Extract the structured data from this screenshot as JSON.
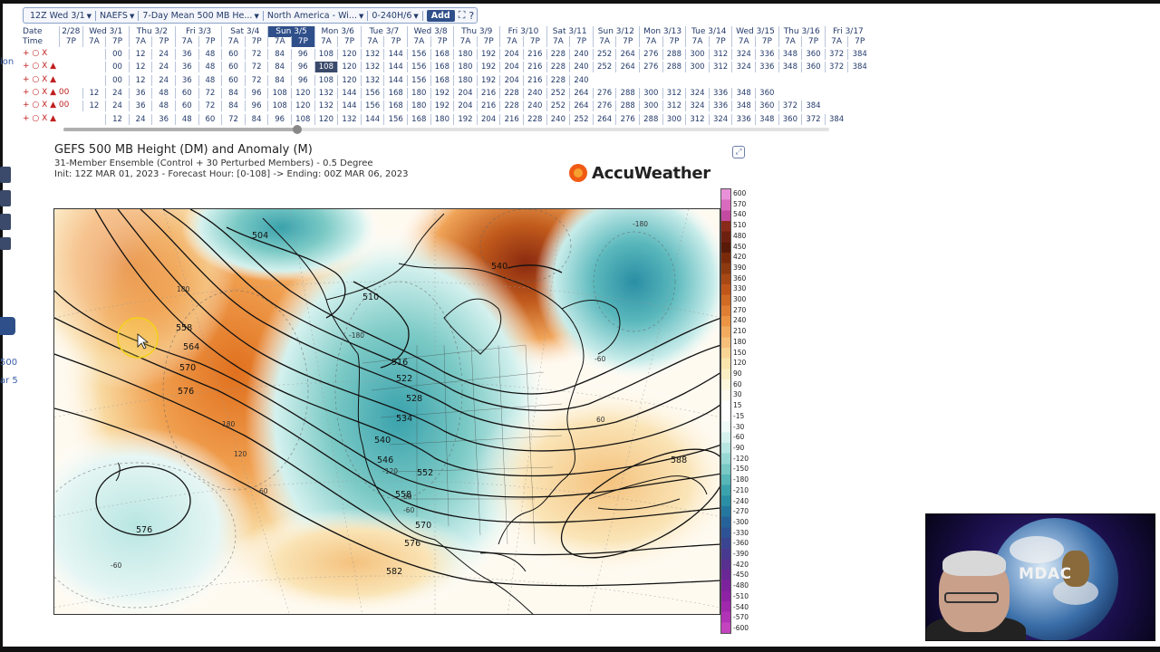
{
  "toolbar": {
    "run": "12Z Wed 3/1",
    "model": "NAEFS",
    "product": "7-Day Mean 500 MB He...",
    "region": "North America - Wi...",
    "range": "0-240H/6",
    "add_label": "Add",
    "fullscreen_icon": "expand-arrows",
    "help_label": "?"
  },
  "grid": {
    "header_date": "Date",
    "header_time": "Time",
    "days": [
      "2/28",
      "Wed 3/1",
      "Thu 3/2",
      "Fri 3/3",
      "Sat 3/4",
      "Sun 3/5",
      "Mon 3/6",
      "Tue 3/7",
      "Wed 3/8",
      "Thu 3/9",
      "Fri 3/10",
      "Sat 3/11",
      "Sun 3/12",
      "Mon 3/13",
      "Tue 3/14",
      "Wed 3/15",
      "Thu 3/16",
      "Fri 3/17"
    ],
    "times": [
      "7P",
      "7A",
      "7P",
      "7A",
      "7P",
      "7A",
      "7P",
      "7A",
      "7P",
      "7A",
      "7P",
      "7A",
      "7P",
      "7A",
      "7P",
      "7A",
      "7P",
      "7A",
      "7P",
      "7A",
      "7P",
      "7A",
      "7P",
      "7A",
      "7P",
      "7A",
      "7P",
      "7A",
      "7P",
      "7A",
      "7P",
      "7A",
      "7P",
      "7A",
      "7P"
    ],
    "rows": [
      {
        "ctrl": "+ ○ X",
        "prefix": "",
        "hours": [
          "00",
          "12",
          "24",
          "36",
          "48",
          "60",
          "72",
          "84",
          "96",
          "108",
          "120",
          "132",
          "144",
          "156",
          "168",
          "180",
          "192",
          "204",
          "216",
          "228",
          "240",
          "252",
          "264",
          "276",
          "288",
          "300",
          "312",
          "324",
          "336",
          "348",
          "360",
          "372",
          "384"
        ]
      },
      {
        "ctrl": "+ ○ X ▲",
        "prefix": "",
        "hours": [
          "00",
          "12",
          "24",
          "36",
          "48",
          "60",
          "72",
          "84",
          "96",
          "108",
          "120",
          "132",
          "144",
          "156",
          "168",
          "180",
          "192",
          "204",
          "216",
          "228",
          "240",
          "252",
          "264",
          "276",
          "288",
          "300",
          "312",
          "324",
          "336",
          "348",
          "360",
          "372",
          "384"
        ]
      },
      {
        "ctrl": "+ ○ X ▲",
        "prefix": "",
        "hours": [
          "00",
          "12",
          "24",
          "36",
          "48",
          "60",
          "72",
          "84",
          "96",
          "108",
          "120",
          "132",
          "144",
          "156",
          "168",
          "180",
          "192",
          "204",
          "216",
          "228",
          "240"
        ]
      },
      {
        "ctrl": "+ ○ X ▲ 00",
        "prefix": "",
        "hours": [
          "12",
          "24",
          "36",
          "48",
          "60",
          "72",
          "84",
          "96",
          "108",
          "120",
          "132",
          "144",
          "156",
          "168",
          "180",
          "192",
          "204",
          "216",
          "228",
          "240",
          "252",
          "264",
          "276",
          "288",
          "300",
          "312",
          "324",
          "336",
          "348",
          "360"
        ]
      },
      {
        "ctrl": "+ ○ X ▲ 00",
        "prefix": "",
        "hours": [
          "12",
          "24",
          "36",
          "48",
          "60",
          "72",
          "84",
          "96",
          "108",
          "120",
          "132",
          "144",
          "156",
          "168",
          "180",
          "192",
          "204",
          "216",
          "228",
          "240",
          "252",
          "264",
          "276",
          "288",
          "300",
          "312",
          "324",
          "336",
          "348",
          "360",
          "372",
          "384"
        ]
      },
      {
        "ctrl": "+ ○ X ▲",
        "prefix": "",
        "hours": [
          "12",
          "24",
          "36",
          "48",
          "60",
          "72",
          "84",
          "96",
          "108",
          "120",
          "132",
          "144",
          "156",
          "168",
          "180",
          "192",
          "204",
          "216",
          "228",
          "240",
          "252",
          "264",
          "276",
          "288",
          "300",
          "312",
          "324",
          "336",
          "348",
          "360",
          "372",
          "384"
        ]
      }
    ]
  },
  "left_panel": {
    "label_1": "ion",
    "label_2": "500",
    "label_3": "ar 5"
  },
  "chart": {
    "title": "GEFS 500 MB Height (DM) and Anomaly (M)",
    "subtitle_1": "31-Member Ensemble (Control + 30 Perturbed Members) - 0.5 Degree",
    "subtitle_2": "Init: 12Z MAR 01, 2023 - Forecast Hour: [0-108] -> Ending: 00Z MAR 06, 2023",
    "brand": "AccuWeather",
    "contour_labels": [
      "504",
      "510",
      "516",
      "522",
      "528",
      "534",
      "540",
      "546",
      "552",
      "558",
      "564",
      "570",
      "576",
      "582",
      "588",
      "540",
      "558",
      "564",
      "570",
      "576",
      "576"
    ],
    "anomaly_labels": [
      "-180",
      "-120",
      "-60",
      "60",
      "120",
      "180",
      "-60",
      "-180",
      "-60"
    ],
    "colorbar": [
      "600",
      "570",
      "540",
      "510",
      "480",
      "450",
      "420",
      "390",
      "360",
      "330",
      "300",
      "270",
      "240",
      "210",
      "180",
      "150",
      "120",
      "90",
      "60",
      "30",
      "15",
      "-15",
      "-30",
      "-60",
      "-90",
      "-120",
      "-150",
      "-180",
      "-210",
      "-240",
      "-270",
      "-300",
      "-330",
      "-360",
      "-390",
      "-420",
      "-450",
      "-480",
      "-510",
      "-540",
      "-570",
      "-600"
    ],
    "colorbar_colors": [
      "#e891d8",
      "#d96bbf",
      "#c24aa0",
      "#8a2a1a",
      "#6e2010",
      "#5a1a08",
      "#7a2a0a",
      "#8e3a10",
      "#a84814",
      "#c0561a",
      "#d06a24",
      "#e07e34",
      "#ec9444",
      "#f2aa5e",
      "#f6c07a",
      "#f8d494",
      "#f8e4ac",
      "#faeec4",
      "#fcf6dc",
      "#fdfbee",
      "#ffffff",
      "#ffffff",
      "#eef9f8",
      "#d4f1ee",
      "#b8e6e2",
      "#98d8d4",
      "#78c8c6",
      "#56b6b8",
      "#3aa2ac",
      "#2a8ea4",
      "#2478a0",
      "#26629a",
      "#2e5296",
      "#3a4592",
      "#483a90",
      "#583090",
      "#6a2896",
      "#7c229c",
      "#8e22a4",
      "#a028ac",
      "#b234b6",
      "#c444c0"
    ]
  },
  "webcam": {
    "overlay_text": "MDAC"
  }
}
